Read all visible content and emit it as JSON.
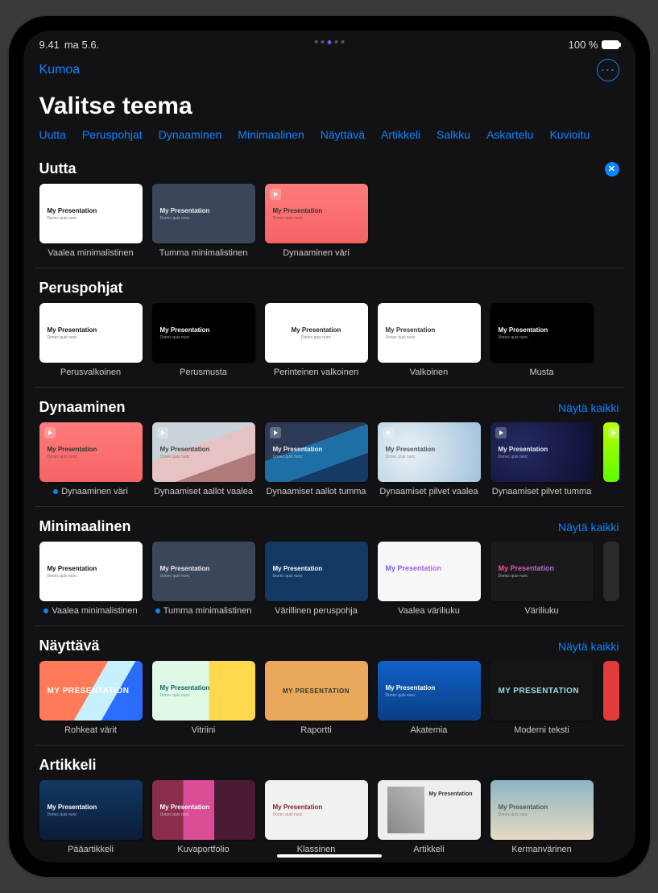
{
  "status": {
    "time": "9.41",
    "date": "ma 5.6.",
    "battery": "100 %"
  },
  "nav": {
    "undo": "Kumoa"
  },
  "title": "Valitse teema",
  "tabs": [
    "Uutta",
    "Peruspohjat",
    "Dynaaminen",
    "Minimaalinen",
    "Näyttävä",
    "Artikkeli",
    "Salkku",
    "Askartelu",
    "Kuvioitu"
  ],
  "show_all": "Näytä kaikki",
  "presentation_placeholder": {
    "title": "My Presentation",
    "subtitle": "Donec quis nunc",
    "subtitle_upper": "DONEC QUIS NUNC"
  },
  "sections": {
    "uutta": {
      "heading": "Uutta",
      "items": [
        {
          "label": "Vaalea minimalistinen",
          "variant": "t-white"
        },
        {
          "label": "Tumma minimalistinen",
          "variant": "t-darkblue"
        },
        {
          "label": "Dynaaminen väri",
          "variant": "t-coral",
          "play": true
        }
      ]
    },
    "perus": {
      "heading": "Peruspohjat",
      "items": [
        {
          "label": "Perusvalkoinen",
          "variant": "t-white"
        },
        {
          "label": "Perusmusta",
          "variant": "t-black"
        },
        {
          "label": "Perinteinen valkoinen",
          "variant": "t-trad"
        },
        {
          "label": "Valkoinen",
          "variant": "t-valko"
        },
        {
          "label": "Musta",
          "variant": "t-black"
        }
      ]
    },
    "dyn": {
      "heading": "Dynaaminen",
      "items": [
        {
          "label": "Dynaaminen väri",
          "variant": "t-coral",
          "play": true,
          "dot": true
        },
        {
          "label": "Dynaamiset aallot vaalea",
          "variant": "t-waves-light",
          "play": true
        },
        {
          "label": "Dynaamiset aallot tumma",
          "variant": "t-waves-dark",
          "play": true
        },
        {
          "label": "Dynaamiset pilvet vaalea",
          "variant": "t-cloud-light",
          "play": true
        },
        {
          "label": "Dynaamiset pilvet tumma",
          "variant": "t-cloud-dark",
          "play": true
        },
        {
          "label": "",
          "variant": "t-neon",
          "play": true
        }
      ]
    },
    "min": {
      "heading": "Minimaalinen",
      "items": [
        {
          "label": "Vaalea minimalistinen",
          "variant": "t-white",
          "dot": true
        },
        {
          "label": "Tumma minimalistinen",
          "variant": "t-darkblue",
          "dot": true
        },
        {
          "label": "Värillinen peruspohja",
          "variant": "t-navy"
        },
        {
          "label": "Vaalea väriliuku",
          "variant": "t-lightgrad"
        },
        {
          "label": "Väriliuku",
          "variant": "t-darkgrad"
        },
        {
          "label": "",
          "variant": "t-grey"
        }
      ]
    },
    "nay": {
      "heading": "Näyttävä",
      "items": [
        {
          "label": "Rohkeat värit",
          "variant": "t-rohkea",
          "big": true
        },
        {
          "label": "Vitriini",
          "variant": "t-vitriini"
        },
        {
          "label": "Raportti",
          "variant": "t-raportti",
          "big": true
        },
        {
          "label": "Akatemia",
          "variant": "t-akatemia"
        },
        {
          "label": "Moderni teksti",
          "variant": "t-moderni",
          "big": true
        },
        {
          "label": "",
          "variant": "t-red"
        }
      ]
    },
    "art": {
      "heading": "Artikkeli",
      "items": [
        {
          "label": "Pääartikkeli",
          "variant": "t-paaar"
        },
        {
          "label": "Kuvaportfolio",
          "variant": "t-kuvaport"
        },
        {
          "label": "Klassinen",
          "variant": "t-klass"
        },
        {
          "label": "Artikkeli",
          "variant": "t-artikk"
        },
        {
          "label": "Kermanvärinen",
          "variant": "t-kerman"
        }
      ]
    }
  }
}
